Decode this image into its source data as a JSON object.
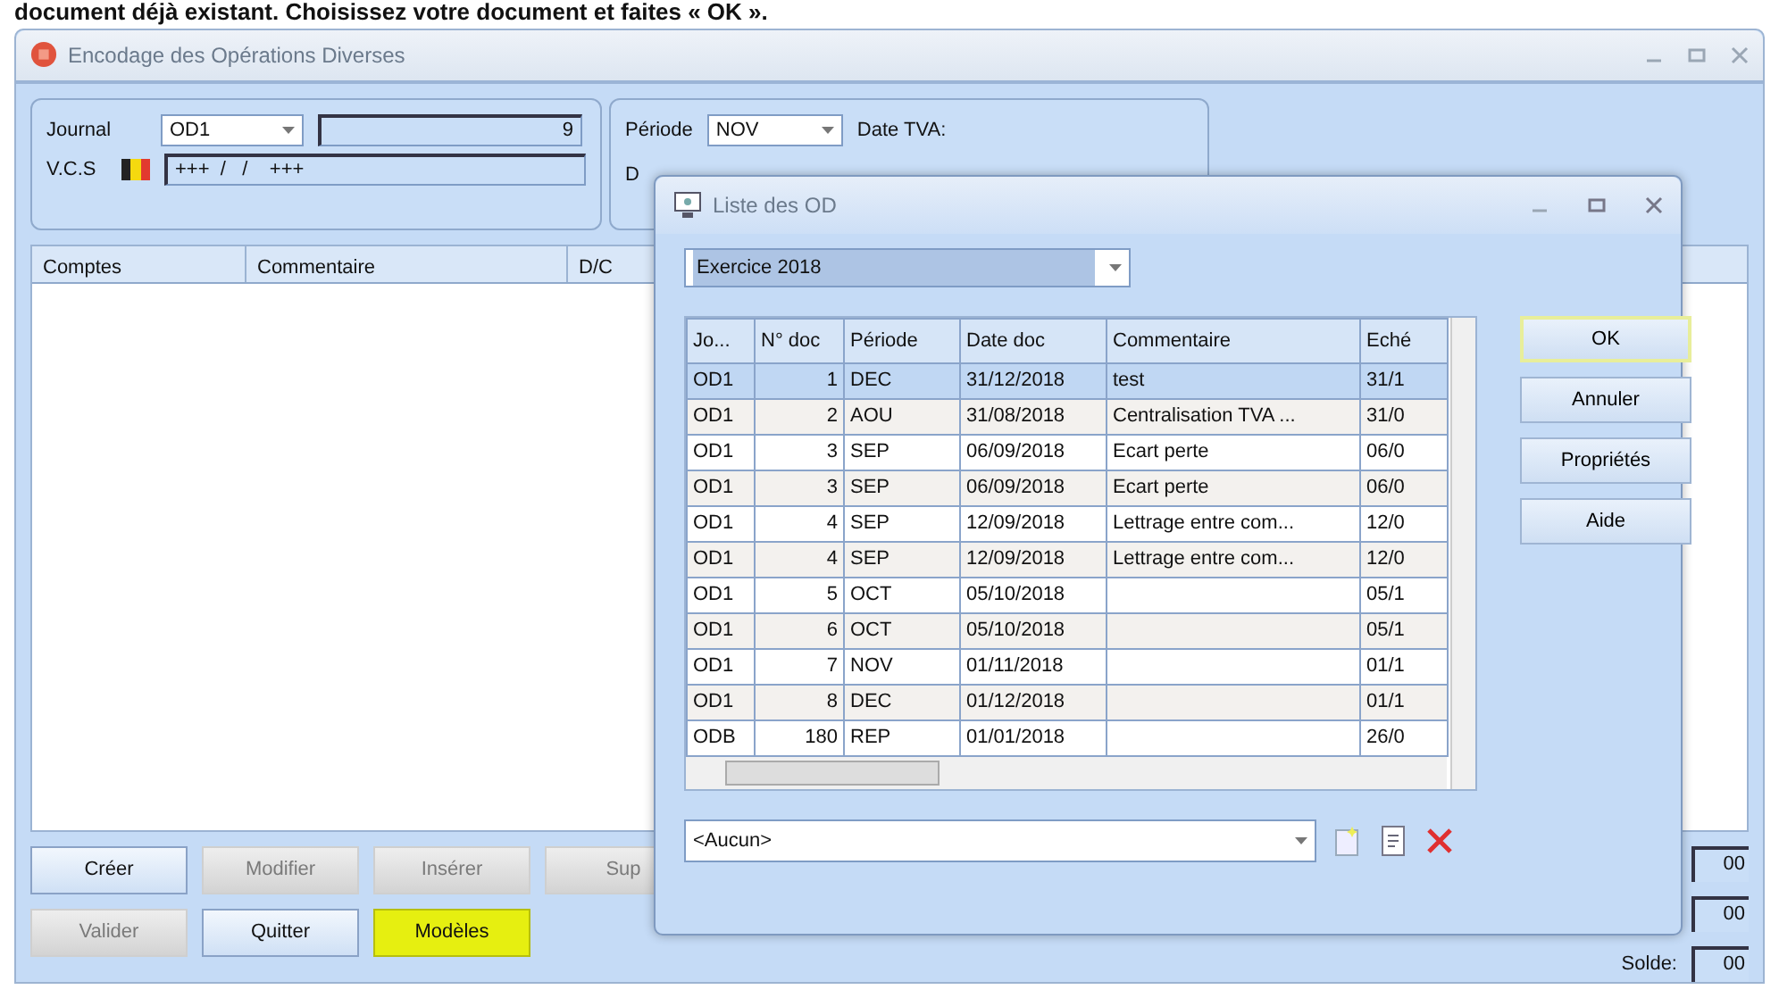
{
  "caption_line": "document déjà existant. Choisissez votre document et faites « OK ».",
  "main_window": {
    "title": "Encodage des Opérations Diverses",
    "journal": {
      "label": "Journal",
      "code": "OD1",
      "number": "9"
    },
    "vcs": {
      "label": "V.C.S",
      "value": "+++  /   /    +++"
    },
    "period": {
      "label": "Période",
      "value": "NOV",
      "vat_date_label": "Date TVA:",
      "second_label": "D"
    },
    "grid_columns": [
      "Comptes",
      "Commentaire",
      "D/C"
    ],
    "buttons": [
      {
        "label": "Créer",
        "disabled": false,
        "highlighted": false
      },
      {
        "label": "Modifier",
        "disabled": true,
        "highlighted": false
      },
      {
        "label": "Insérer",
        "disabled": true,
        "highlighted": false
      },
      {
        "label": "Sup",
        "disabled": true,
        "highlighted": false
      },
      {
        "label": "Valider",
        "disabled": true,
        "highlighted": false
      },
      {
        "label": "Quitter",
        "disabled": false,
        "highlighted": false
      },
      {
        "label": "Modèles",
        "disabled": false,
        "highlighted": true
      }
    ],
    "totals": [
      "00",
      "00",
      "00"
    ],
    "balance_label": "Solde:"
  },
  "dialog": {
    "title": "Liste des OD",
    "exercise": "Exercice 2018",
    "columns": [
      "Jo...",
      "N° doc",
      "Période",
      "Date doc",
      "Commentaire",
      "Eché"
    ],
    "rows": [
      {
        "cells": [
          "OD1",
          "1",
          "DEC",
          "31/12/2018",
          "test",
          "31/1"
        ],
        "selected": true
      },
      {
        "cells": [
          "OD1",
          "2",
          "AOU",
          "31/08/2018",
          "Centralisation TVA ...",
          "31/0"
        ],
        "selected": false
      },
      {
        "cells": [
          "OD1",
          "3",
          "SEP",
          "06/09/2018",
          "Ecart perte",
          "06/0"
        ],
        "selected": false
      },
      {
        "cells": [
          "OD1",
          "3",
          "SEP",
          "06/09/2018",
          "Ecart perte",
          "06/0"
        ],
        "selected": false
      },
      {
        "cells": [
          "OD1",
          "4",
          "SEP",
          "12/09/2018",
          "Lettrage entre com...",
          "12/0"
        ],
        "selected": false
      },
      {
        "cells": [
          "OD1",
          "4",
          "SEP",
          "12/09/2018",
          "Lettrage entre com...",
          "12/0"
        ],
        "selected": false
      },
      {
        "cells": [
          "OD1",
          "5",
          "OCT",
          "05/10/2018",
          "",
          "05/1"
        ],
        "selected": false
      },
      {
        "cells": [
          "OD1",
          "6",
          "OCT",
          "05/10/2018",
          "",
          "05/1"
        ],
        "selected": false
      },
      {
        "cells": [
          "OD1",
          "7",
          "NOV",
          "01/11/2018",
          "",
          "01/1"
        ],
        "selected": false
      },
      {
        "cells": [
          "OD1",
          "8",
          "DEC",
          "01/12/2018",
          "",
          "01/1"
        ],
        "selected": false
      },
      {
        "cells": [
          "ODB",
          "180",
          "REP",
          "01/01/2018",
          "",
          "26/0"
        ],
        "selected": false
      }
    ],
    "filter": "<Aucun>",
    "buttons": [
      {
        "label": "OK",
        "default": true
      },
      {
        "label": "Annuler",
        "default": false
      },
      {
        "label": "Propriétés",
        "default": false
      },
      {
        "label": "Aide",
        "default": false
      }
    ]
  }
}
